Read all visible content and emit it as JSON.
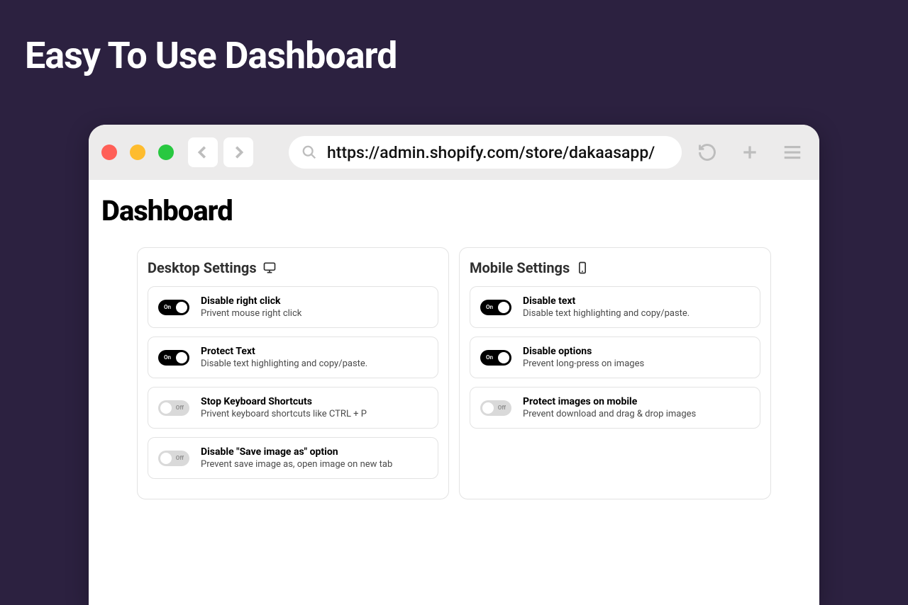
{
  "hero_title": "Easy To Use Dashboard",
  "browser": {
    "url": "https://admin.shopify.com/store/dakaasapp/"
  },
  "dashboard": {
    "title": "Dashboard",
    "desktop": {
      "heading": "Desktop Settings",
      "items": [
        {
          "state": "on",
          "label": "On",
          "title": "Disable right click",
          "desc": "Privent mouse right click"
        },
        {
          "state": "on",
          "label": "On",
          "title": "Protect Text",
          "desc": "Disable text highlighting and copy/paste."
        },
        {
          "state": "off",
          "label": "Off",
          "title": "Stop Keyboard Shortcuts",
          "desc": "Privent keyboard shortcuts like CTRL + P"
        },
        {
          "state": "off",
          "label": "Off",
          "title": "Disable \"Save image as\" option",
          "desc": "Prevent save image as, open image on new tab"
        }
      ]
    },
    "mobile": {
      "heading": "Mobile Settings",
      "items": [
        {
          "state": "on",
          "label": "On",
          "title": "Disable text",
          "desc": "Disable text highlighting and copy/paste."
        },
        {
          "state": "on",
          "label": "On",
          "title": "Disable options",
          "desc": "Prevent long-press on images"
        },
        {
          "state": "off",
          "label": "Off",
          "title": "Protect images on mobile",
          "desc": "Prevent download and drag & drop images"
        }
      ]
    }
  }
}
